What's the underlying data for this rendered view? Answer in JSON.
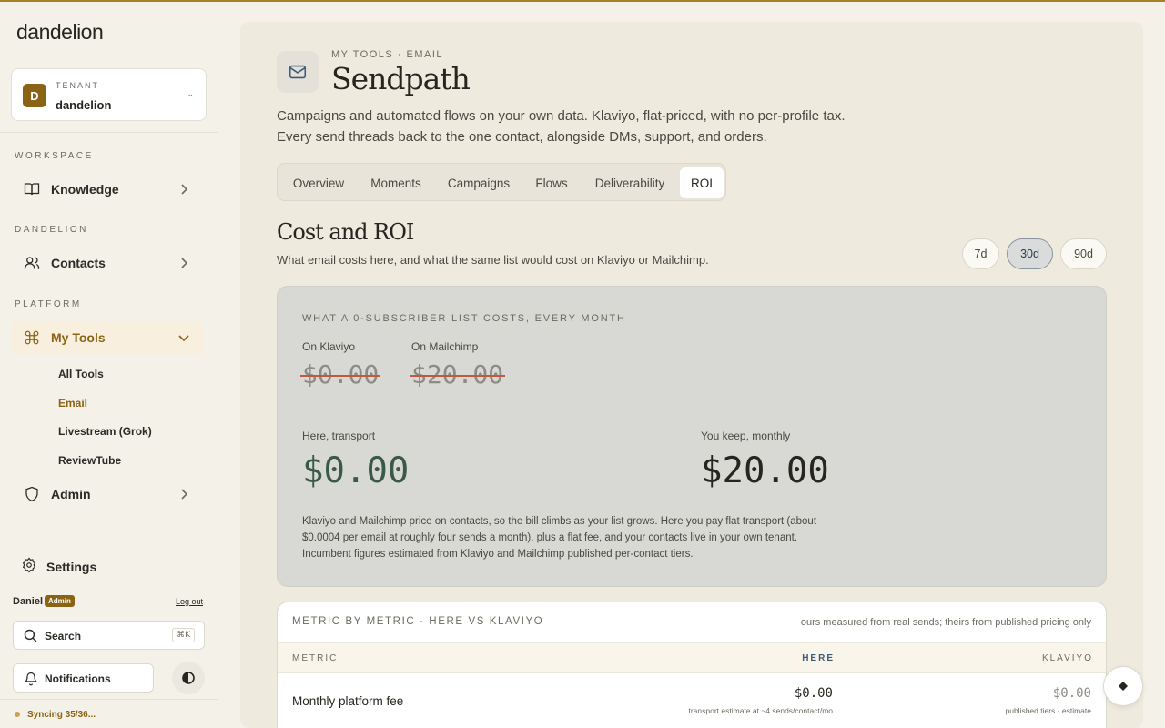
{
  "brand": {
    "logo": "dandelion",
    "accent": "#8a6414"
  },
  "tenant": {
    "initial": "D",
    "label": "TENANT",
    "name": "dandelion"
  },
  "sidebar": {
    "sections": {
      "workspace": "WORKSPACE",
      "dandelion": "DANDELION",
      "platform": "PLATFORM"
    },
    "items": {
      "knowledge": "Knowledge",
      "contacts": "Contacts",
      "my_tools": "My Tools",
      "admin": "Admin"
    },
    "my_tools_sub": [
      "All Tools",
      "Email",
      "Livestream (Grok)",
      "ReviewTube"
    ],
    "settings": "Settings"
  },
  "user": {
    "name": "Daniel",
    "role": "Admin",
    "logout": "Log out"
  },
  "search": {
    "label": "Search",
    "shortcut": "⌘K"
  },
  "notifications": {
    "label": "Notifications"
  },
  "sync": {
    "status": "Syncing 35/36..."
  },
  "header": {
    "breadcrumb": "MY TOOLS · EMAIL",
    "title": "Sendpath",
    "description": "Campaigns and automated flows on your own data. Klaviyo, flat-priced, with no per-profile tax. Every send threads back to the one contact, alongside DMs, support, and orders."
  },
  "tabs": [
    "Overview",
    "Moments",
    "Campaigns",
    "Flows",
    "Deliverability",
    "ROI"
  ],
  "active_tab": "ROI",
  "section": {
    "title": "Cost and ROI",
    "description": "What email costs here, and what the same list would cost on Klaviyo or Mailchimp."
  },
  "ranges": [
    "7d",
    "30d",
    "90d"
  ],
  "active_range": "30d",
  "cost": {
    "heading": "WHAT A 0-SUBSCRIBER LIST COSTS, EVERY MONTH",
    "klaviyo_label": "On Klaviyo",
    "klaviyo_value": "$0.00",
    "mailchimp_label": "On Mailchimp",
    "mailchimp_value": "$20.00",
    "here_label": "Here, transport",
    "here_value": "$0.00",
    "keep_label": "You keep, monthly",
    "keep_value": "$20.00",
    "note": "Klaviyo and Mailchimp price on contacts, so the bill climbs as your list grows. Here you pay flat transport (about $0.0004 per email at roughly four sends a month), plus a flat fee, and your contacts live in your own tenant. Incumbent figures estimated from Klaviyo and Mailchimp published per-contact tiers."
  },
  "metrics": {
    "title": "METRIC BY METRIC · HERE VS KLAVIYO",
    "note": "ours measured from real sends; theirs from published pricing only",
    "columns": {
      "metric": "METRIC",
      "here": "HERE",
      "klaviyo": "KLAVIYO"
    },
    "rows": [
      {
        "label": "Monthly platform fee",
        "here": "$0.00",
        "here_sub": "transport estimate at ~4 sends/contact/mo",
        "klaviyo": "$0.00",
        "klaviyo_sub": "published tiers · estimate"
      }
    ]
  }
}
